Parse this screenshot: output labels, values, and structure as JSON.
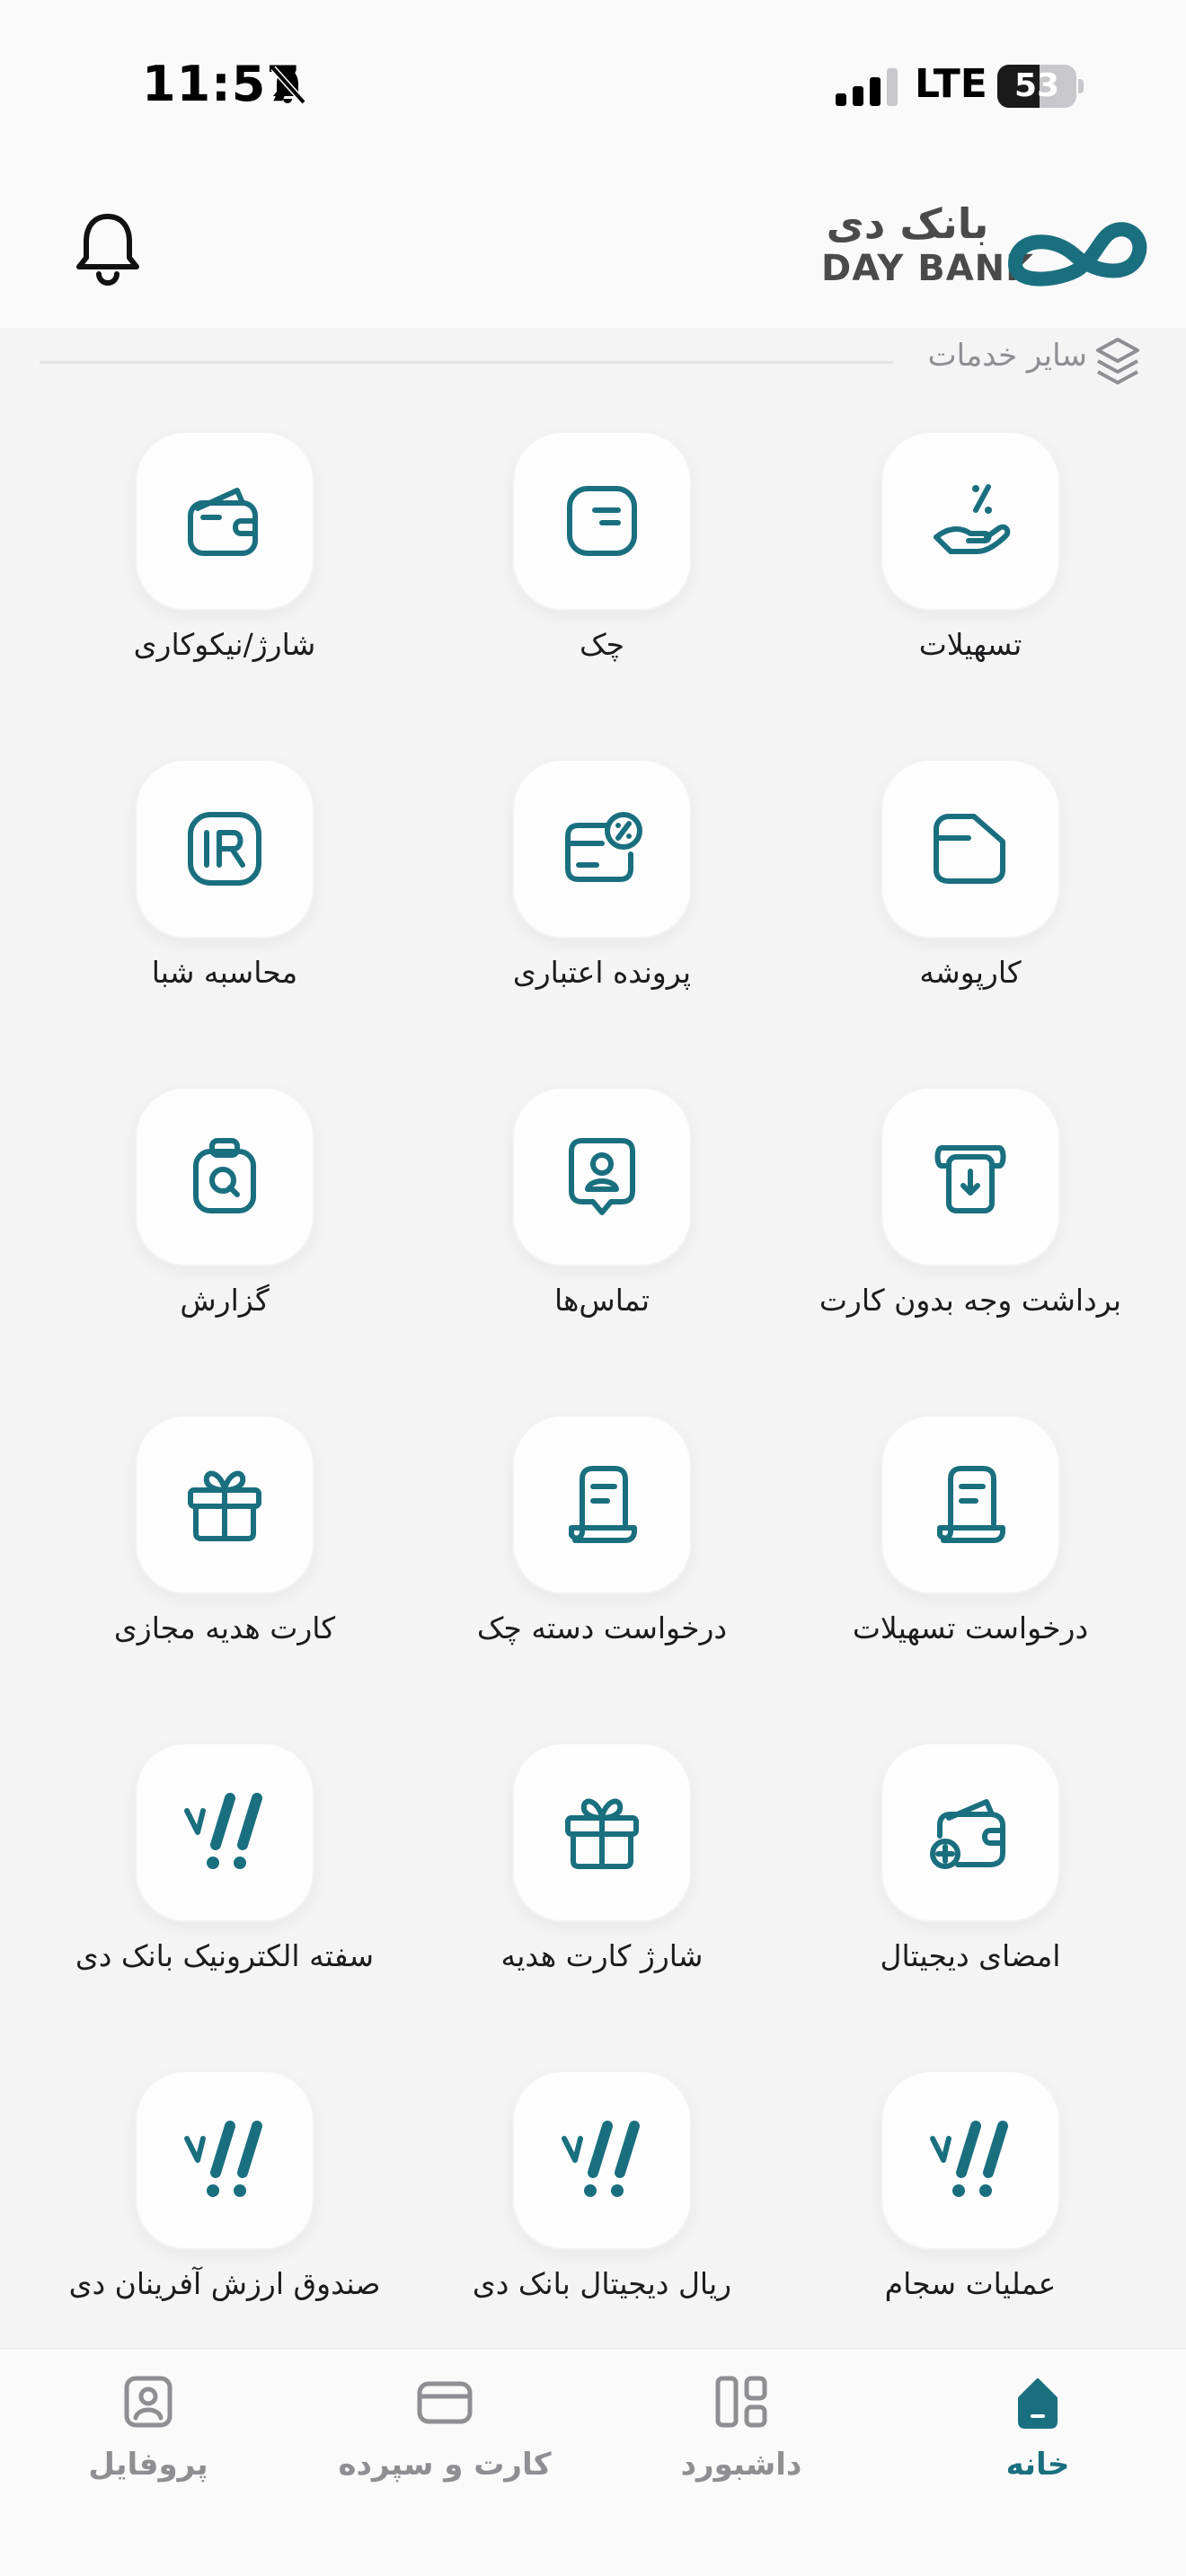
{
  "status_bar": {
    "time": "11:57",
    "network": "LTE",
    "battery": "53"
  },
  "header": {
    "logo_fa": "بانک دی",
    "logo_en": "DAY BANK"
  },
  "section": {
    "title": "سایر خدمات"
  },
  "services": [
    {
      "label": "تسهیلات",
      "icon": "loan-hand-icon"
    },
    {
      "label": "چک",
      "icon": "cheque-icon"
    },
    {
      "label": "شارژ/نیکوکاری",
      "icon": "wallet-icon"
    },
    {
      "label": "کارپوشه",
      "icon": "folder-icon"
    },
    {
      "label": "پرونده اعتباری",
      "icon": "credit-card-percent-icon"
    },
    {
      "label": "محاسبه شبا",
      "icon": "iban-ir-icon"
    },
    {
      "label": "برداشت وجه بدون کارت",
      "icon": "cardless-withdraw-icon"
    },
    {
      "label": "تماس‌ها",
      "icon": "contact-icon"
    },
    {
      "label": "گزارش",
      "icon": "report-search-icon"
    },
    {
      "label": "درخواست تسهیلات",
      "icon": "request-document-icon"
    },
    {
      "label": "درخواست دسته چک",
      "icon": "request-document-icon"
    },
    {
      "label": "کارت هدیه مجازی",
      "icon": "gift-icon"
    },
    {
      "label": "امضای دیجیتال",
      "icon": "wallet-plus-icon"
    },
    {
      "label": "شارژ کارت هدیه",
      "icon": "gift-icon"
    },
    {
      "label": "سفته الکترونیک بانک دی",
      "icon": "exclamation-promo-icon"
    },
    {
      "label": "عملیات سجام",
      "icon": "exclamation-promo-icon"
    },
    {
      "label": "ریال دیجیتال بانک دی",
      "icon": "exclamation-promo-icon"
    },
    {
      "label": "صندوق ارزش آفرینان دی",
      "icon": "exclamation-promo-icon"
    }
  ],
  "nav": [
    {
      "label": "خانه",
      "icon": "home-icon",
      "active": true
    },
    {
      "label": "داشبورد",
      "icon": "dashboard-icon",
      "active": false
    },
    {
      "label": "کارت و سپرده",
      "icon": "card-icon",
      "active": false
    },
    {
      "label": "پروفایل",
      "icon": "profile-icon",
      "active": false
    }
  ],
  "colors": {
    "accent": "#1a6f7f",
    "background": "#f4f4f5",
    "muted": "#8e8e93"
  }
}
